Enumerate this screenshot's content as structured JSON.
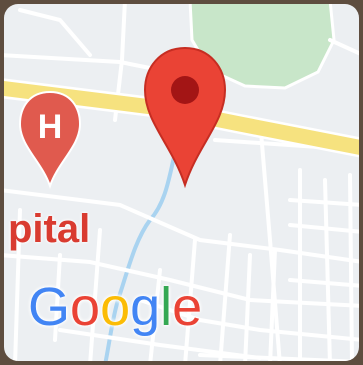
{
  "map": {
    "place_label": "pital",
    "icons": {
      "hospital_marker": "hospital-marker-icon",
      "location_pin": "location-pin-icon"
    },
    "hospital_marker_letter": "H",
    "attribution": {
      "logo_text": [
        "G",
        "o",
        "o",
        "g",
        "l",
        "e"
      ],
      "logo_colors": [
        "#4285f4",
        "#ea4335",
        "#fbbc05",
        "#4285f4",
        "#34a853",
        "#ea4335"
      ]
    },
    "colors": {
      "land": "#eceff2",
      "park": "#c8e6c9",
      "highway": "#f6e27f",
      "water": "#a9d3f0",
      "road": "#ffffff",
      "pin": "#ea4335",
      "pin_dot": "#a31515",
      "hospital_marker": "#e05a4e"
    }
  }
}
